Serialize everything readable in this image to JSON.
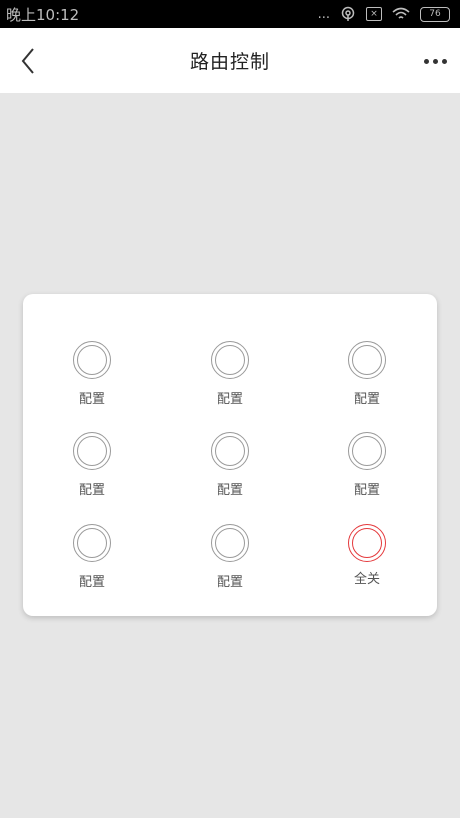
{
  "status_bar": {
    "time": "晚上10:12",
    "dots": "...",
    "sim_icon_glyph": "×",
    "battery": "76"
  },
  "header": {
    "title": "路由控制",
    "back_icon": "chevron-left-icon",
    "more_icon": "more-dots-icon"
  },
  "grid": {
    "items": [
      {
        "label": "配置"
      },
      {
        "label": "配置"
      },
      {
        "label": "配置"
      },
      {
        "label": "配置"
      },
      {
        "label": "配置"
      },
      {
        "label": "配置"
      },
      {
        "label": "配置"
      },
      {
        "label": "配置"
      },
      {
        "label": "全关"
      }
    ]
  },
  "colors": {
    "ring_default": "#9a9a9a",
    "ring_active": "#e4393c"
  }
}
